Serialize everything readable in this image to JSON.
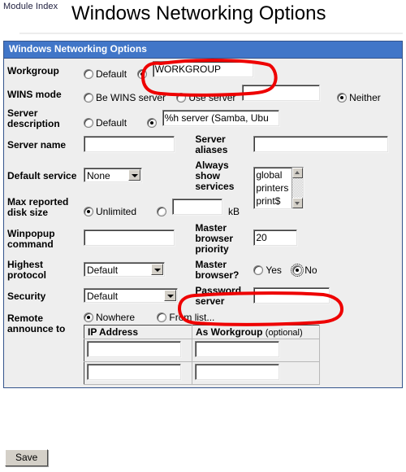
{
  "header": {
    "module_index_link": "Module Index",
    "page_title": "Windows Networking Options"
  },
  "section": {
    "title": "Windows Networking Options"
  },
  "colors": {
    "section_bar": "#4176c8",
    "table_border": "#34548c",
    "page_background": "#eeeeee",
    "annotation_red": "#ee0000"
  },
  "fields": {
    "workgroup": {
      "label": "Workgroup",
      "default_option": "Default",
      "default_selected": false,
      "value_selected": true,
      "value": "WORKGROUP"
    },
    "wins_mode": {
      "label": "WINS mode",
      "be_server_option": "Be WINS server",
      "be_server_selected": false,
      "use_server_option": "Use server",
      "use_server_selected": false,
      "use_server_value": "",
      "neither_option": "Neither",
      "neither_selected": true
    },
    "server_description": {
      "label": "Server description",
      "default_option": "Default",
      "default_selected": false,
      "value_selected": true,
      "value": "%h server (Samba, Ubu"
    },
    "server_name": {
      "label": "Server name",
      "value": ""
    },
    "server_aliases": {
      "label": "Server aliases",
      "value": ""
    },
    "default_service": {
      "label": "Default service",
      "selected": "None"
    },
    "always_show_services": {
      "label": "Always show services",
      "options": [
        "global",
        "printers",
        "print$"
      ]
    },
    "max_reported_disk_size": {
      "label": "Max reported disk size",
      "unlimited_option": "Unlimited",
      "unlimited_selected": true,
      "value_selected": false,
      "value": "",
      "unit": "kB"
    },
    "winpopup_command": {
      "label": "Winpopup command",
      "value": ""
    },
    "master_browser_priority": {
      "label": "Master browser priority",
      "value": "20"
    },
    "highest_protocol": {
      "label": "Highest protocol",
      "selected": "Default"
    },
    "master_browser": {
      "label": "Master browser?",
      "yes_option": "Yes",
      "yes_selected": false,
      "no_option": "No",
      "no_selected": true
    },
    "security": {
      "label": "Security",
      "selected": "Default"
    },
    "password_server": {
      "label": "Password server",
      "value": ""
    },
    "remote_announce": {
      "label": "Remote announce to",
      "nowhere_option": "Nowhere",
      "nowhere_selected": true,
      "from_list_option": "From list...",
      "from_list_selected": false,
      "columns": [
        "IP Address",
        "As Workgroup",
        "(optional)"
      ],
      "rows": [
        {
          "ip": "",
          "workgroup": ""
        },
        {
          "ip": "",
          "workgroup": ""
        }
      ]
    }
  },
  "footer": {
    "save_label": "Save"
  }
}
